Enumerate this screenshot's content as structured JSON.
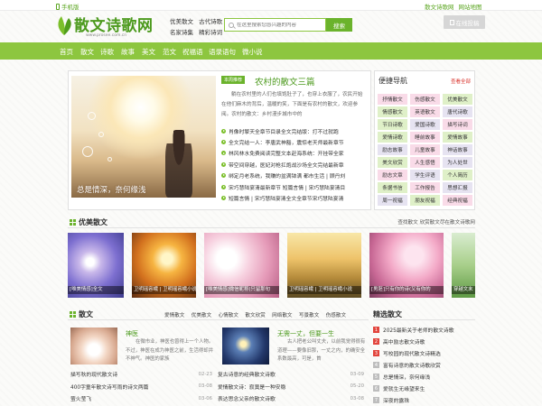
{
  "colors": {
    "brand_green": "#8dc63f",
    "dark_green": "#4c9a1d",
    "accent_red": "#e2443c"
  },
  "topbar": {
    "mobile_label": "手机版",
    "site_link": "散文诗歌网",
    "sitemap_link": "网站地图"
  },
  "header": {
    "logo_text": "散文诗歌网",
    "logo_url_text": "www.prosee.com.cn",
    "quick_links": [
      "优美散文",
      "古代诗歌",
      "名家诗集",
      "精彩诗词"
    ],
    "search": {
      "placeholder": "在这里搜索您感兴趣的内容",
      "button": "搜索"
    },
    "submit_label": "在线投稿"
  },
  "nav": [
    "首页",
    "散文",
    "诗歌",
    "故事",
    "美文",
    "范文",
    "祝福语",
    "语录语句",
    "微小说"
  ],
  "featured": {
    "image_caption": "总是情深，奈何缘浅",
    "tag": "本周推荐",
    "title": "农村的散文三篇",
    "summary": "躺在农村里的人们也填饱肚子了，也穿上衣服了，农民开始在他们麻木的背后，温暖的笑，下面是有农村的散文，欢迎参阅。农村的散文：乡村漫步城市中的",
    "links": [
      "肖像时擎天全章节目录全文完结版：打不过就跑",
      "全文完结一人：李唐武神豁，震惊老天师最新章节",
      "林风林水免费阅读完整文本赶海系统：开挂带全家",
      "带空间穿越，医妃对枪扛炮战沙场全文完结最新章",
      "绑定月老系统，我赚的盆满钵满 都市生活 | 顾丹刘",
      "宋巧慧陆宴清最新章节 短篇言情 | 宋巧慧陆宴清目",
      "短篇言情 | 宋巧慧陆宴清全文全章节宋巧慧陆宴清"
    ]
  },
  "quick_nav": {
    "title": "便捷导航",
    "more": "查看全部",
    "tags": [
      "抒情散文",
      "伤感散文",
      "优美散文",
      "情感散文",
      "英语散文",
      "唐代诗歌",
      "节日诗歌",
      "爱国诗歌",
      "描写诗词",
      "爱情诗歌",
      "睡前故事",
      "爱情故事",
      "励志故事",
      "儿童故事",
      "神话故事",
      "美文欣赏",
      "人生感悟",
      "为人处世",
      "励志文章",
      "学生评语",
      "个人简历",
      "条据书信",
      "工作报告",
      "思想汇报",
      "周一祝福",
      "朋友祝福",
      "经典祝福"
    ]
  },
  "gallery": {
    "title": "优美散文",
    "tagline": "查找散文 欣赏散文尽在散文诗歌网",
    "items": [
      "[唯美情感]全文",
      "卫明瑶容峨 | 卫明瑶容峨小说",
      "[唯美情感]微信昵称(只留那句",
      "卫明瑶容峨 | 卫明瑶容峨小说",
      "[男胚]只有你的诗(又有你的",
      "穿越文末"
    ]
  },
  "prose": {
    "title": "散文",
    "tabs": [
      "爱情散文",
      "优美散文",
      "心情散文",
      "散文欣赏",
      "网络散文",
      "写景散文",
      "伤感散文"
    ],
    "features": [
      {
        "title": "神医",
        "summary": "在微市业，神医也曾得上一个人物。不过，神医在成为神医之前，生活得却并不神气。神医的家族"
      },
      {
        "title": "无需一丈，但要一生",
        "summary": "古人把老公叫丈夫，以前我觉得很有道理——要像旧那，一丈之内，的确安全系数最高，可是，首"
      }
    ],
    "list_left": [
      {
        "title": "描写秋的现代散文诗",
        "date": "02-23"
      },
      {
        "title": "400字童年散文诗写雨的诗文两篇",
        "date": "03-08"
      },
      {
        "title": "萤火莹飞",
        "date": "03-06"
      }
    ],
    "list_right": [
      {
        "title": "复古诗意的经典散文诗歌",
        "date": "03-09"
      },
      {
        "title": "爱情散文诗：寂寞是一种安稳",
        "date": "05-20"
      },
      {
        "title": "表达思念父亲的散文诗歌",
        "date": "03-08"
      }
    ]
  },
  "selected": {
    "title": "精选散文",
    "items": [
      {
        "rank": "1",
        "title": "2025最新关于老师的散文诗歌"
      },
      {
        "rank": "2",
        "title": "高中励志散文诗歌"
      },
      {
        "rank": "3",
        "title": "写校园的现代散文诗精选"
      },
      {
        "rank": "4",
        "title": "富有诗意的散文诗歌欣赏"
      },
      {
        "rank": "5",
        "title": "总是情深，奈何缘浅"
      },
      {
        "rank": "6",
        "title": "爱就生无缘望来生"
      },
      {
        "rank": "7",
        "title": "深夜的露珠"
      }
    ]
  }
}
